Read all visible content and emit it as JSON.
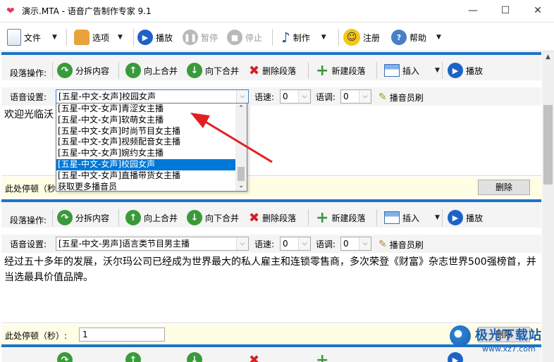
{
  "window": {
    "title": "演示.MTA - 语音广告制作专家 9.1",
    "controls": {
      "minimize": "—",
      "maximize": "☐",
      "close": "✕"
    }
  },
  "toolbar": {
    "file": "文件",
    "options": "选项",
    "play": "播放",
    "pause": "暂停",
    "stop": "停止",
    "make": "制作",
    "register": "注册",
    "help": "帮助"
  },
  "paragraph_labels": {
    "ops": "段落操作:",
    "split": "分拆内容",
    "merge_up": "向上合并",
    "merge_down": "向下合并",
    "delete_para": "删除段落",
    "new_para": "新建段落",
    "insert": "插入",
    "play": "播放",
    "voice_settings": "语音设置:",
    "speed": "语速:",
    "pitch": "语调:",
    "announcer_brush": "播音员刷",
    "pause_label": "此处停顿（秒）:",
    "delete": "删除"
  },
  "panel1": {
    "voice": "[五星-中文-女声]校园女声",
    "speed": "0",
    "pitch": "0",
    "text": "欢迎光临沃",
    "pause_label_partial": "此处停顿（秒"
  },
  "panel2": {
    "voice": "[五星-中文-男声]语言类节目男主播",
    "speed": "0",
    "pitch": "0",
    "text": "经过五十多年的发展，沃尔玛公司已经成为世界最大的私人雇主和连锁零售商，多次荣登《财富》杂志世界500强榜首，并当选最具价值品牌。",
    "pause_value": "1"
  },
  "dropdown": {
    "items": [
      "[五星-中文-女声]青涩女主播",
      "[五星-中文-女声]软萌女主播",
      "[五星-中文-女声]时尚节目女主播",
      "[五星-中文-女声]视频配音女主播",
      "[五星-中文-女声]婉约女主播",
      "[五星-中文-女声]校园女声",
      "[五星-中文-女声]直播带货女主播",
      "获取更多播音员"
    ],
    "selected_index": 5
  },
  "watermark": {
    "text": "极光下载站",
    "url": "www.xz7.com"
  },
  "colors": {
    "accent": "#1e73c7",
    "selection": "#0078d7",
    "footer_bg": "#fffde4",
    "arrow": "#e02020"
  }
}
